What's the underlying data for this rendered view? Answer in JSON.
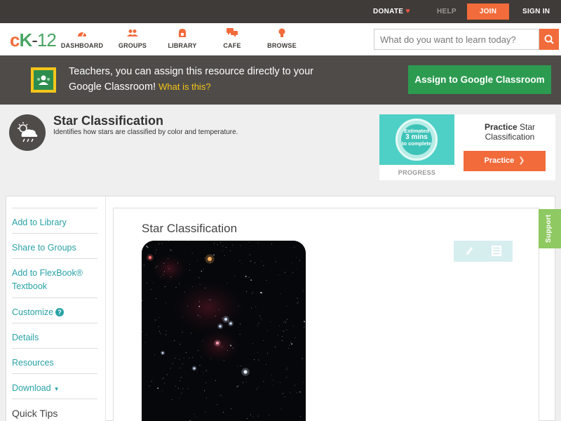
{
  "topbar": {
    "donate": "DONATE",
    "help": "HELP",
    "join": "JOIN",
    "signin": "SIGN IN"
  },
  "nav": {
    "logo": {
      "c": "c",
      "k": "K",
      "dash": "-",
      "num": "12"
    },
    "items": [
      {
        "label": "DASHBOARD",
        "icon": "dashboard-icon"
      },
      {
        "label": "GROUPS",
        "icon": "groups-icon"
      },
      {
        "label": "LIBRARY",
        "icon": "library-icon"
      },
      {
        "label": "CAFE",
        "icon": "cafe-icon"
      },
      {
        "label": "BROWSE",
        "icon": "browse-icon"
      }
    ],
    "search_placeholder": "What do you want to learn today?"
  },
  "classroom_banner": {
    "text": "Teachers, you can assign this resource directly to your Google Classroom!",
    "what_link": "What is this?",
    "assign_button": "Assign to Google Classroom"
  },
  "concept": {
    "title": "Star Classification",
    "description": "Identifies how stars are classified by color and temperature."
  },
  "practice": {
    "estimated": "Estimated",
    "mins_value": "3",
    "mins_unit": "mins",
    "to_complete": "to complete",
    "progress_label": "PROGRESS",
    "title_bold": "Practice",
    "title_rest": "Star Classification",
    "button": "Practice"
  },
  "sidebar": {
    "items": [
      {
        "label": "Add to Library"
      },
      {
        "label": "Share to Groups"
      },
      {
        "label": "Add to FlexBook®",
        "label2": "Textbook"
      },
      {
        "label": "Customize"
      },
      {
        "label": "Details"
      },
      {
        "label": "Resources"
      },
      {
        "label": "Download"
      }
    ],
    "quick_tips": "Quick Tips"
  },
  "content": {
    "title": "Star Classification"
  },
  "support": "Support",
  "colors": {
    "accent_orange": "#f26b3a",
    "accent_green": "#2c9b50",
    "teal_link": "#29a2a6",
    "support_green": "#8fc962",
    "dark_bar": "#3e3b38"
  }
}
